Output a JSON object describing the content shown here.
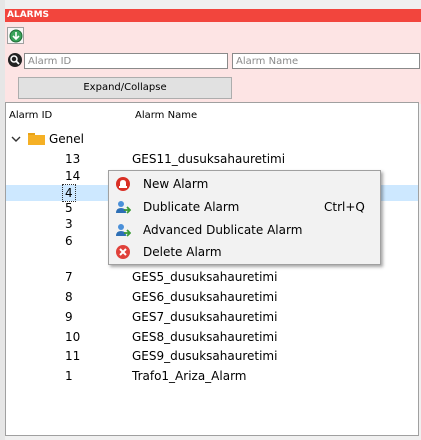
{
  "panel": {
    "title": "ALARMS",
    "accent_color": "#f2453d",
    "header_bg": "#fde4e4",
    "expand_icon": "expand-tree-icon",
    "search_icon": "search-icon"
  },
  "search": {
    "alarm_id_placeholder": "Alarm ID",
    "alarm_id_value": "",
    "alarm_name_placeholder": "Alarm Name",
    "alarm_name_value": ""
  },
  "toolbar": {
    "expand_collapse_label": "Expand/Collapse"
  },
  "tree": {
    "columns": {
      "id": "Alarm ID",
      "name": "Alarm Name"
    },
    "group": {
      "label": "Genel",
      "expanded": true,
      "icon": "folder-icon"
    },
    "rows": [
      {
        "id": "13",
        "name": "GES11_dusuksahauretimi"
      },
      {
        "id": "14",
        "name": ""
      },
      {
        "id": "4",
        "name": "",
        "selected": true
      },
      {
        "id": "5",
        "name": ""
      },
      {
        "id": "3",
        "name": ""
      },
      {
        "id": "6",
        "name": ""
      },
      {
        "id": "7",
        "name": "GES5_dusuksahauretimi"
      },
      {
        "id": "8",
        "name": "GES6_dusuksahauretimi"
      },
      {
        "id": "9",
        "name": "GES7_dusuksahauretimi"
      },
      {
        "id": "10",
        "name": "GES8_dusuksahauretimi"
      },
      {
        "id": "11",
        "name": "GES9_dusuksahauretimi"
      },
      {
        "id": "1",
        "name": "Trafo1_Ariza_Alarm"
      }
    ]
  },
  "context_menu": {
    "items": [
      {
        "label": "New Alarm",
        "shortcut": "",
        "icon": "new-alarm-icon"
      },
      {
        "label": "Dublicate Alarm",
        "shortcut": "Ctrl+Q",
        "icon": "duplicate-icon"
      },
      {
        "label": "Advanced Dublicate Alarm",
        "shortcut": "",
        "icon": "advanced-duplicate-icon"
      },
      {
        "label": "Delete Alarm",
        "shortcut": "",
        "icon": "delete-icon"
      }
    ]
  }
}
